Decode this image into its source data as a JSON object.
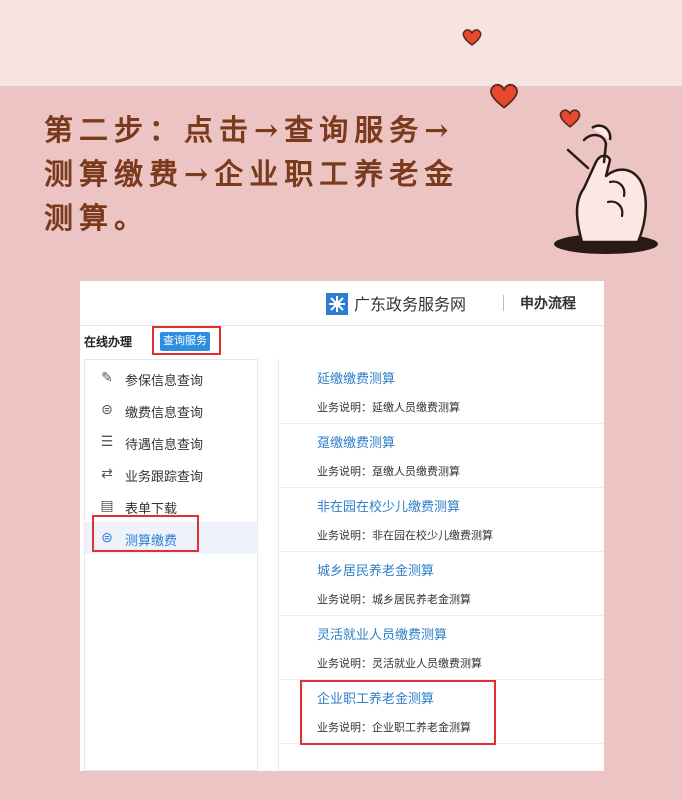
{
  "heading": "第二步：点击→查询服务→测算缴费→企业职工养老金测算。",
  "header": {
    "site_name": "广东政务服务网",
    "link": "申办流程"
  },
  "subnav": {
    "label": "在线办理",
    "query_button": "查询服务"
  },
  "sidebar": {
    "items": [
      {
        "label": "参保信息查询",
        "icon": "document-edit-icon"
      },
      {
        "label": "缴费信息查询",
        "icon": "payment-icon"
      },
      {
        "label": "待遇信息查询",
        "icon": "document-list-icon"
      },
      {
        "label": "业务跟踪查询",
        "icon": "tracking-icon"
      },
      {
        "label": "表单下载",
        "icon": "form-icon"
      },
      {
        "label": "测算缴费",
        "icon": "payment-icon",
        "active": true
      }
    ]
  },
  "services": [
    {
      "title": "延缴缴费测算",
      "desc": "业务说明：延缴人员缴费测算"
    },
    {
      "title": "趸缴缴费测算",
      "desc": "业务说明：趸缴人员缴费测算"
    },
    {
      "title": "非在园在校少儿缴费测算",
      "desc": "业务说明：非在园在校少儿缴费测算"
    },
    {
      "title": "城乡居民养老金测算",
      "desc": "业务说明：城乡居民养老金测算"
    },
    {
      "title": "灵活就业人员缴费测算",
      "desc": "业务说明：灵活就业人员缴费测算"
    },
    {
      "title": "企业职工养老金测算",
      "desc": "业务说明：企业职工养老金测算"
    }
  ],
  "colors": {
    "background": "#edc4c4",
    "heading": "#7a3a1c",
    "accent_blue": "#2e8fe0",
    "highlight_red": "#e03030",
    "heart": "#e8482f"
  }
}
